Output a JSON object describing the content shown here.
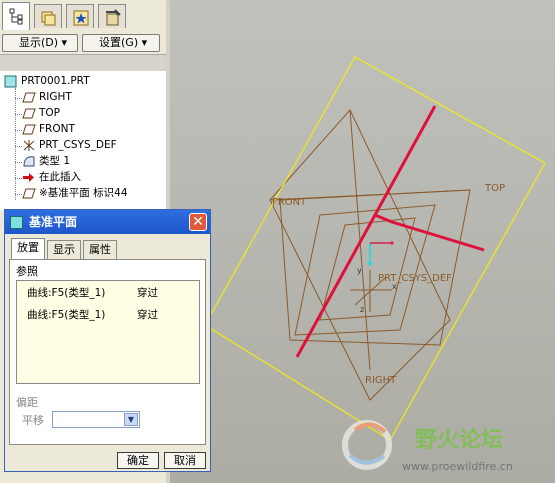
{
  "left_panel": {
    "tabs": [
      {
        "icon": "model-tree-icon",
        "active": true
      },
      {
        "icon": "folder-browser-icon",
        "active": false
      },
      {
        "icon": "favorites-icon",
        "active": false
      },
      {
        "icon": "connections-icon",
        "active": false
      }
    ],
    "display_menu_label": "显示(D) ▾",
    "settings_menu_label": "设置(G) ▾",
    "tree": {
      "root": "PRT0001.PRT",
      "items": [
        {
          "label": "RIGHT",
          "icon": "datum-plane-icon"
        },
        {
          "label": "TOP",
          "icon": "datum-plane-icon"
        },
        {
          "label": "FRONT",
          "icon": "datum-plane-icon"
        },
        {
          "label": "PRT_CSYS_DEF",
          "icon": "csys-icon"
        },
        {
          "label": "类型 1",
          "icon": "curve-feature-icon"
        },
        {
          "label": "在此插入",
          "icon": "insert-here-arrow-icon"
        },
        {
          "label": "※基准平面 标识44",
          "icon": "datum-plane-icon"
        }
      ]
    }
  },
  "dialog": {
    "title": "基准平面",
    "tabs": [
      "放置",
      "显示",
      "属性"
    ],
    "active_tab": "放置",
    "references_label": "参照",
    "references": [
      {
        "ref": "曲线:F5(类型_1)",
        "constraint": "穿过"
      },
      {
        "ref": "曲线:F5(类型_1)",
        "constraint": "穿过"
      }
    ],
    "offset_label": "偏距",
    "move_label": "平移",
    "move_value": "",
    "ok_label": "确定",
    "cancel_label": "取消"
  },
  "viewport": {
    "labels": {
      "front": "FRONT",
      "top": "TOP",
      "right": "RIGHT",
      "csys": "PRT_CSYS_DEF",
      "axis_x": "x",
      "axis_y": "y",
      "axis_z": "z"
    },
    "colors": {
      "background": "#b8b8b2",
      "datum_plane": "#8b5a2b",
      "new_plane": "#ffff00",
      "curve": "#e0103c",
      "csys": "#3fd0d0"
    },
    "watermark": {
      "title": "野火论坛",
      "url": "www.proewildfire.cn"
    }
  }
}
